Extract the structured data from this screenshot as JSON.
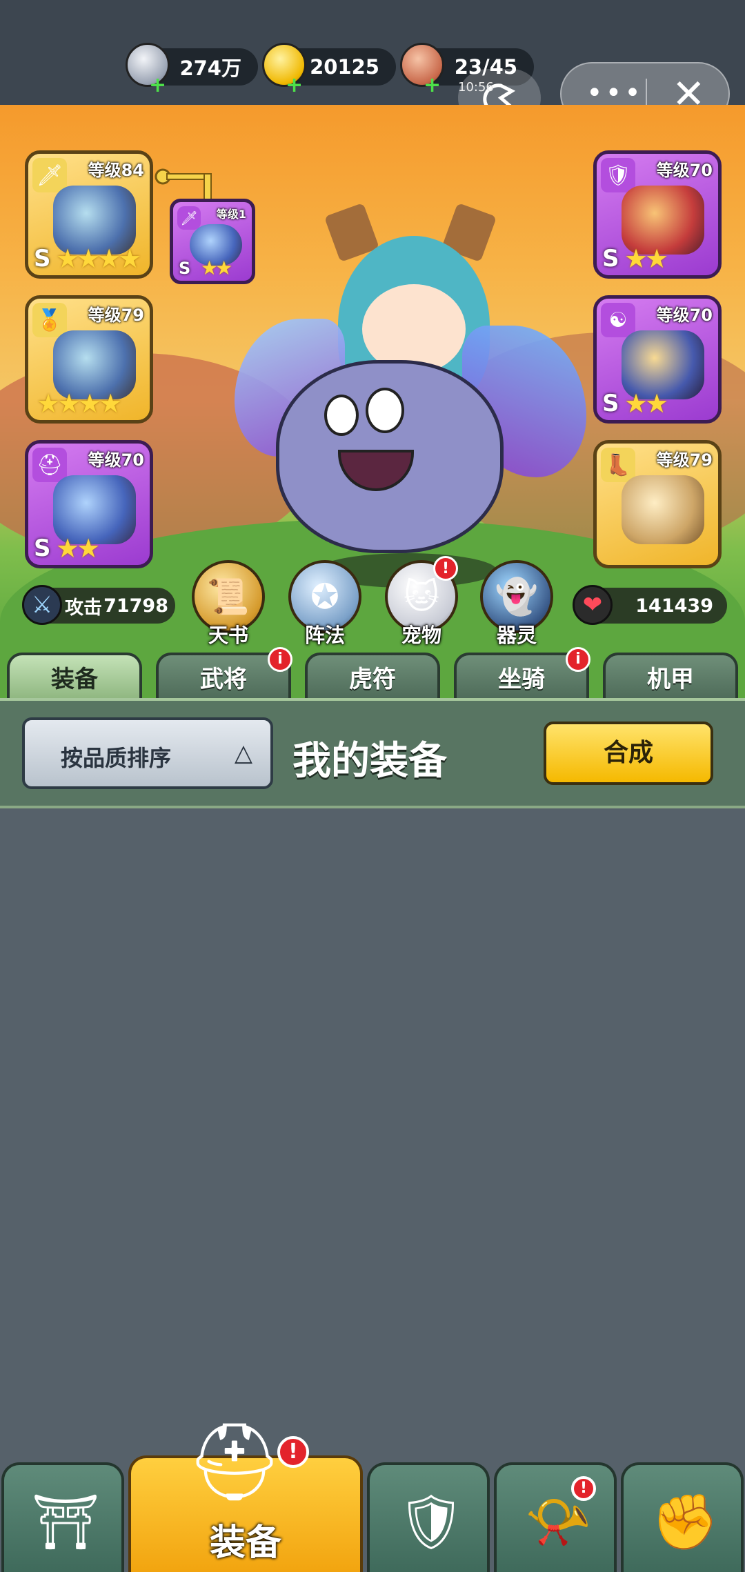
{
  "resources": {
    "silver": {
      "value": "274万",
      "icon": "silver-coin-icon"
    },
    "gold": {
      "value": "20125",
      "icon": "gold-ingot-icon"
    },
    "stamina": {
      "value": "23/45",
      "icon": "meat-icon"
    }
  },
  "system": {
    "time": "10:56",
    "more_label": "•••",
    "close_label": "✕"
  },
  "equipment_slots": {
    "left": [
      {
        "level": "等级84",
        "grade": "S",
        "stars": 4,
        "type": "weapon",
        "rarity": "gold"
      },
      {
        "level": "等级79",
        "grade": "",
        "stars": 4,
        "type": "medal",
        "rarity": "gold"
      },
      {
        "level": "等级70",
        "grade": "S",
        "stars": 2,
        "type": "helmet",
        "rarity": "purple"
      }
    ],
    "linked": {
      "level": "等级1",
      "grade": "S",
      "stars": 2,
      "type": "weapon",
      "rarity": "purple"
    },
    "right": [
      {
        "level": "等级70",
        "grade": "S",
        "stars": 2,
        "type": "armor",
        "rarity": "purple"
      },
      {
        "level": "等级70",
        "grade": "S",
        "stars": 2,
        "type": "taiji",
        "rarity": "purple"
      },
      {
        "level": "等级79",
        "grade": "",
        "stars": 0,
        "type": "boots",
        "rarity": "gold"
      }
    ]
  },
  "stats": {
    "attack": {
      "label": "攻击",
      "value": "71798"
    },
    "hp": {
      "value": "141439"
    }
  },
  "functions": [
    {
      "label": "天书",
      "icon": "scroll-icon",
      "alert": false
    },
    {
      "label": "阵法",
      "icon": "formation-icon",
      "alert": false
    },
    {
      "label": "宠物",
      "icon": "cat-icon",
      "alert": true
    },
    {
      "label": "器灵",
      "icon": "spirit-icon",
      "alert": false
    }
  ],
  "tabs": [
    {
      "label": "装备",
      "active": true,
      "alert": false
    },
    {
      "label": "武将",
      "active": false,
      "alert": true
    },
    {
      "label": "虎符",
      "active": false,
      "alert": false
    },
    {
      "label": "坐骑",
      "active": false,
      "alert": true
    },
    {
      "label": "机甲",
      "active": false,
      "alert": false
    }
  ],
  "panel": {
    "sort_label": "按品质排序",
    "title": "我的装备",
    "merge_label": "合成"
  },
  "bottom_nav": [
    {
      "label": "",
      "icon": "gate-icon",
      "active": false,
      "alert": false
    },
    {
      "label": "装备",
      "icon": "helmet-icon",
      "active": true,
      "alert": true
    },
    {
      "label": "",
      "icon": "shield-sword-icon",
      "active": false,
      "alert": false
    },
    {
      "label": "",
      "icon": "horn-icon",
      "active": false,
      "alert": true
    },
    {
      "label": "",
      "icon": "fist-icon",
      "active": false,
      "alert": false
    }
  ],
  "alert_mark": "!",
  "alert_mark_small": "i",
  "colors": {
    "gold_rarity": "#f0b52a",
    "purple_rarity": "#9b3bd0",
    "alert": "#e3232b"
  }
}
